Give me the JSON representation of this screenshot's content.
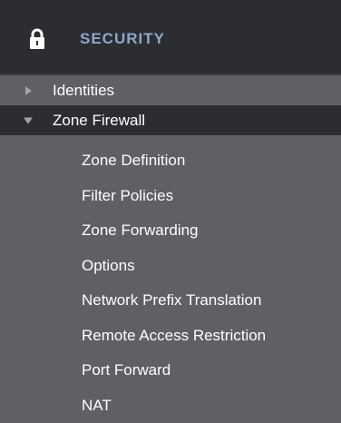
{
  "header": {
    "title": "SECURITY",
    "icon": "lock-icon"
  },
  "groups": [
    {
      "label": "Identities",
      "expanded": false
    },
    {
      "label": "Zone Firewall",
      "expanded": true
    }
  ],
  "zone_firewall_items": [
    "Zone Definition",
    "Filter Policies",
    "Zone Forwarding",
    "Options",
    "Network Prefix Translation",
    "Remote Access Restriction",
    "Port Forward",
    "NAT"
  ],
  "colors": {
    "panel_bg": "#5e6066",
    "header_bg": "#2b2d31",
    "header_title": "#8ea7c9",
    "text": "#ffffff"
  }
}
